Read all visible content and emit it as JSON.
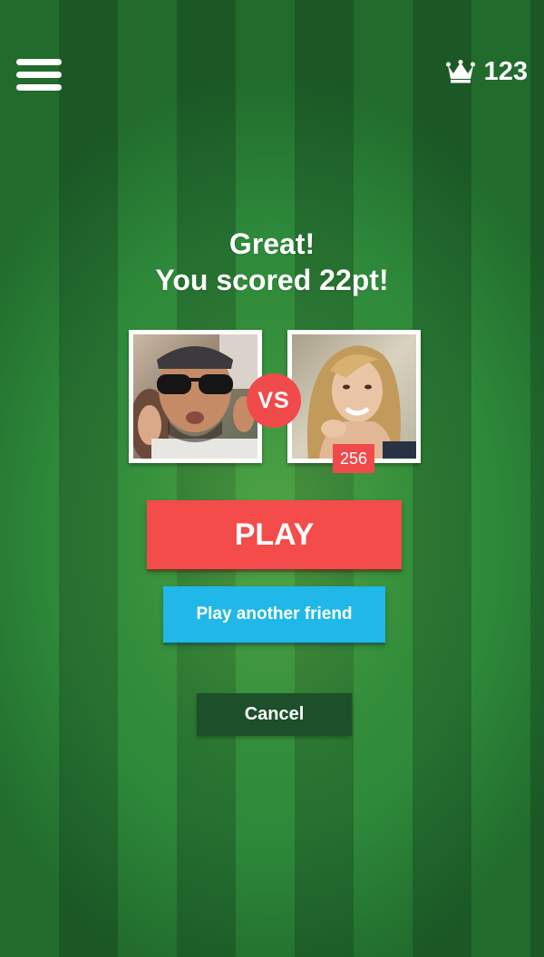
{
  "header": {
    "menu_icon": "hamburger-menu-icon",
    "crown_icon": "crown-icon",
    "score": "123"
  },
  "result": {
    "line1": "Great!",
    "line2": "You scored 22pt!"
  },
  "match": {
    "vs_label": "VS",
    "opponent_score": "256"
  },
  "buttons": {
    "play": "PLAY",
    "play_another": "Play another friend",
    "cancel": "Cancel"
  },
  "colors": {
    "field_light": "#2e8a3a",
    "field_dark": "#256f30",
    "accent_red": "#f44c4b",
    "accent_blue": "#1fb8e8",
    "cancel_green": "#1c4f2a"
  }
}
